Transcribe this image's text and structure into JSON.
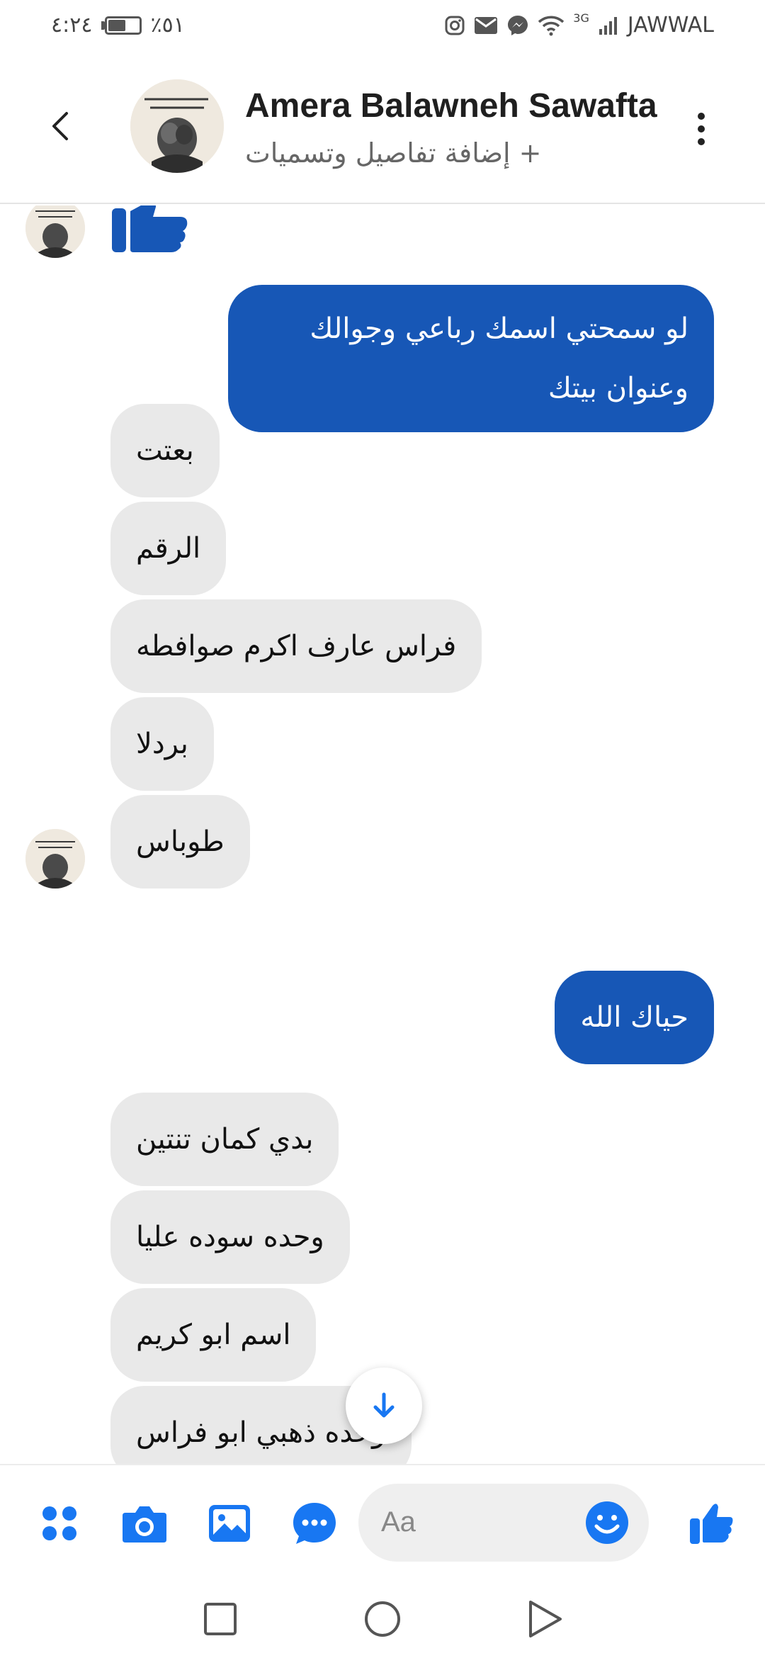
{
  "status_bar": {
    "time": "٤:٢٤",
    "battery": "٪٥١",
    "carrier": "JAWWAL",
    "network": "3G"
  },
  "header": {
    "contact_name": "Amera Balawneh Sawafta",
    "subtitle": "+ إضافة تفاصيل وتسميات"
  },
  "messages": [
    {
      "id": 1,
      "direction": "outgoing",
      "lines": [
        "لو سمحتي اسمك رباعي وجوالك",
        "وعنوان بيتك"
      ]
    },
    {
      "id": 2,
      "direction": "incoming",
      "text": "بعتت"
    },
    {
      "id": 3,
      "direction": "incoming",
      "text": "الرقم"
    },
    {
      "id": 4,
      "direction": "incoming",
      "text": "فراس عارف اكرم صوافطه"
    },
    {
      "id": 5,
      "direction": "incoming",
      "text": "بردلا"
    },
    {
      "id": 6,
      "direction": "incoming",
      "text": "طوباس"
    },
    {
      "id": 7,
      "direction": "outgoing",
      "text": "حياك الله"
    },
    {
      "id": 8,
      "direction": "incoming",
      "text": "بدي كمان تنتين"
    },
    {
      "id": 9,
      "direction": "incoming",
      "text": "وحده سوده عليا"
    },
    {
      "id": 10,
      "direction": "incoming",
      "text": "اسم ابو كريم"
    },
    {
      "id": 11,
      "direction": "incoming",
      "text": "وحده ذهبي ابو فراس"
    }
  ],
  "composer": {
    "placeholder": "Aa"
  },
  "colors": {
    "accent": "#1877f2",
    "outgoing_bubble": "#1757b6",
    "incoming_bubble": "#e9e9e9"
  }
}
